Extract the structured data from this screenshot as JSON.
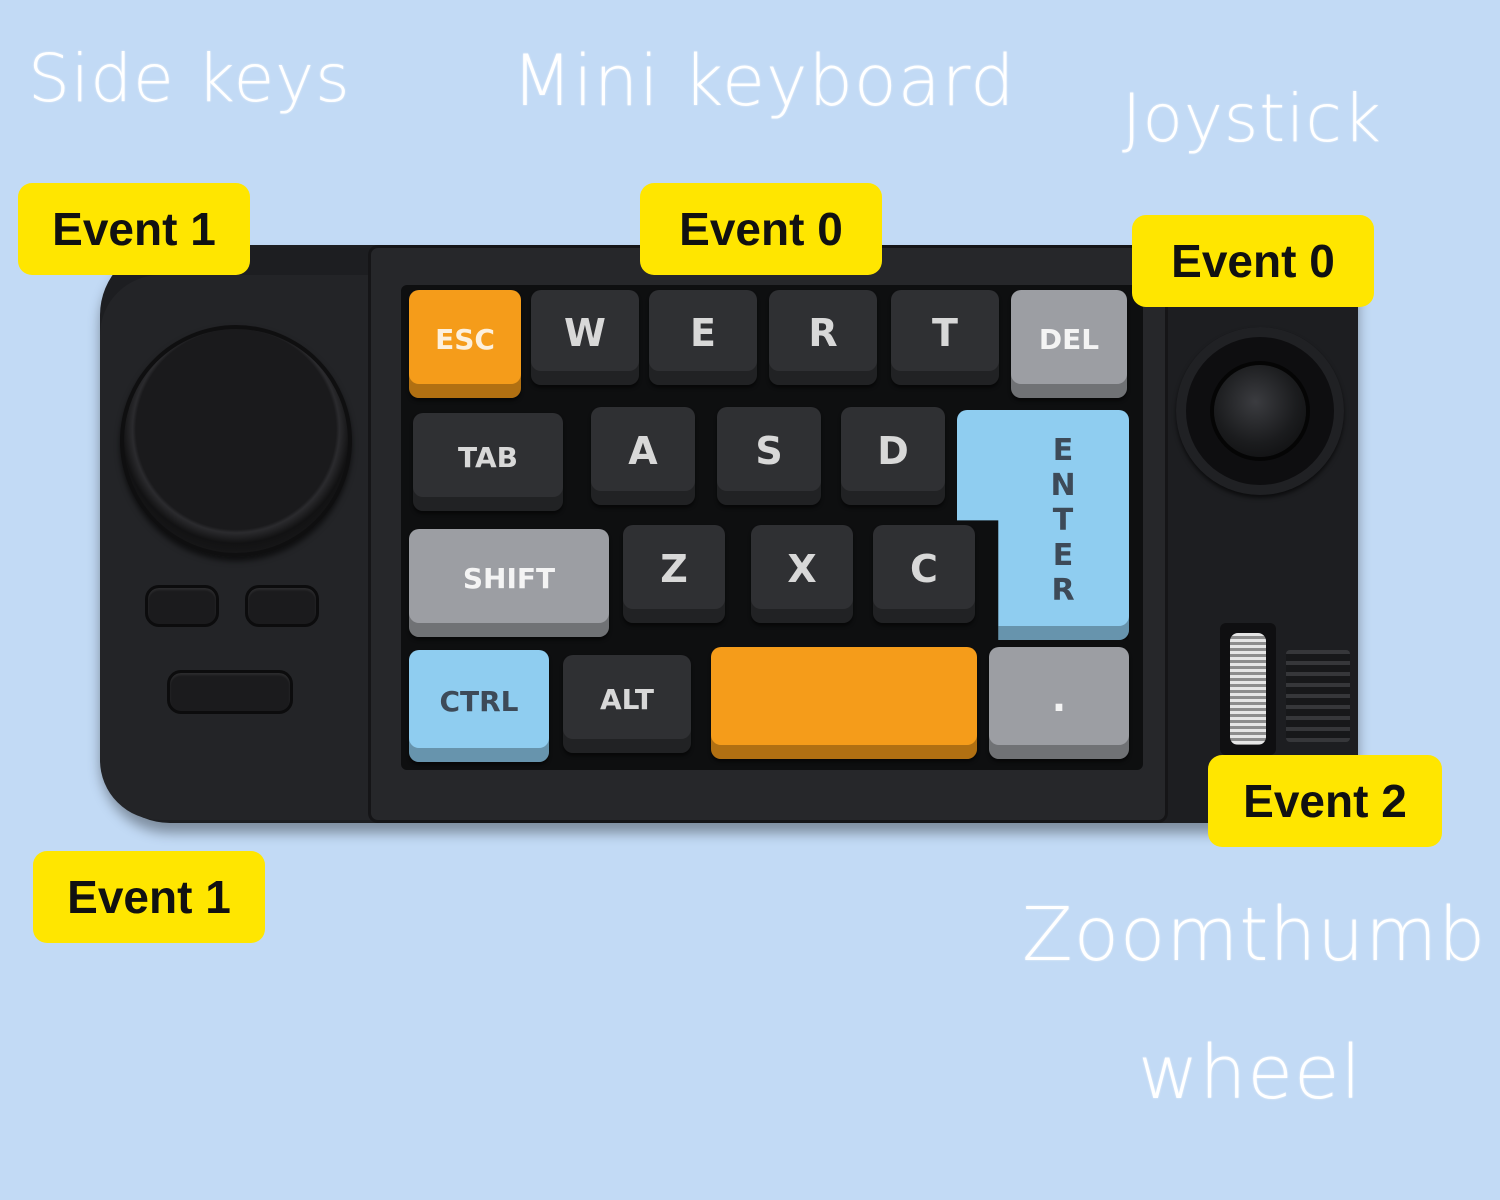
{
  "titles": {
    "side_keys": "Side keys",
    "mini_keyboard": "Mini keyboard",
    "joystick": "Joystick",
    "zoom_line1": "Zoomthumb",
    "zoom_line2": "wheel"
  },
  "badges": {
    "side_top": "Event 1",
    "keyboard": "Event 0",
    "joystick": "Event 0",
    "wheel": "Event 2",
    "side_bottom": "Event 1"
  },
  "keys": {
    "esc": "ESC",
    "w": "W",
    "e": "E",
    "r": "R",
    "t": "T",
    "del": "DEL",
    "tab": "TAB",
    "a": "A",
    "s": "S",
    "d": "D",
    "enter": "ENTER",
    "shift": "SHIFT",
    "z": "Z",
    "x": "X",
    "c": "C",
    "ctrl": "CTRL",
    "alt": "ALT",
    "dot": "."
  },
  "colors": {
    "background": "#c2daf5",
    "badge": "#ffe600",
    "key_orange": "#f59c1a",
    "key_blue": "#8fcdf0",
    "key_gray": "#9c9ea3",
    "key_black": "#2f3033"
  }
}
